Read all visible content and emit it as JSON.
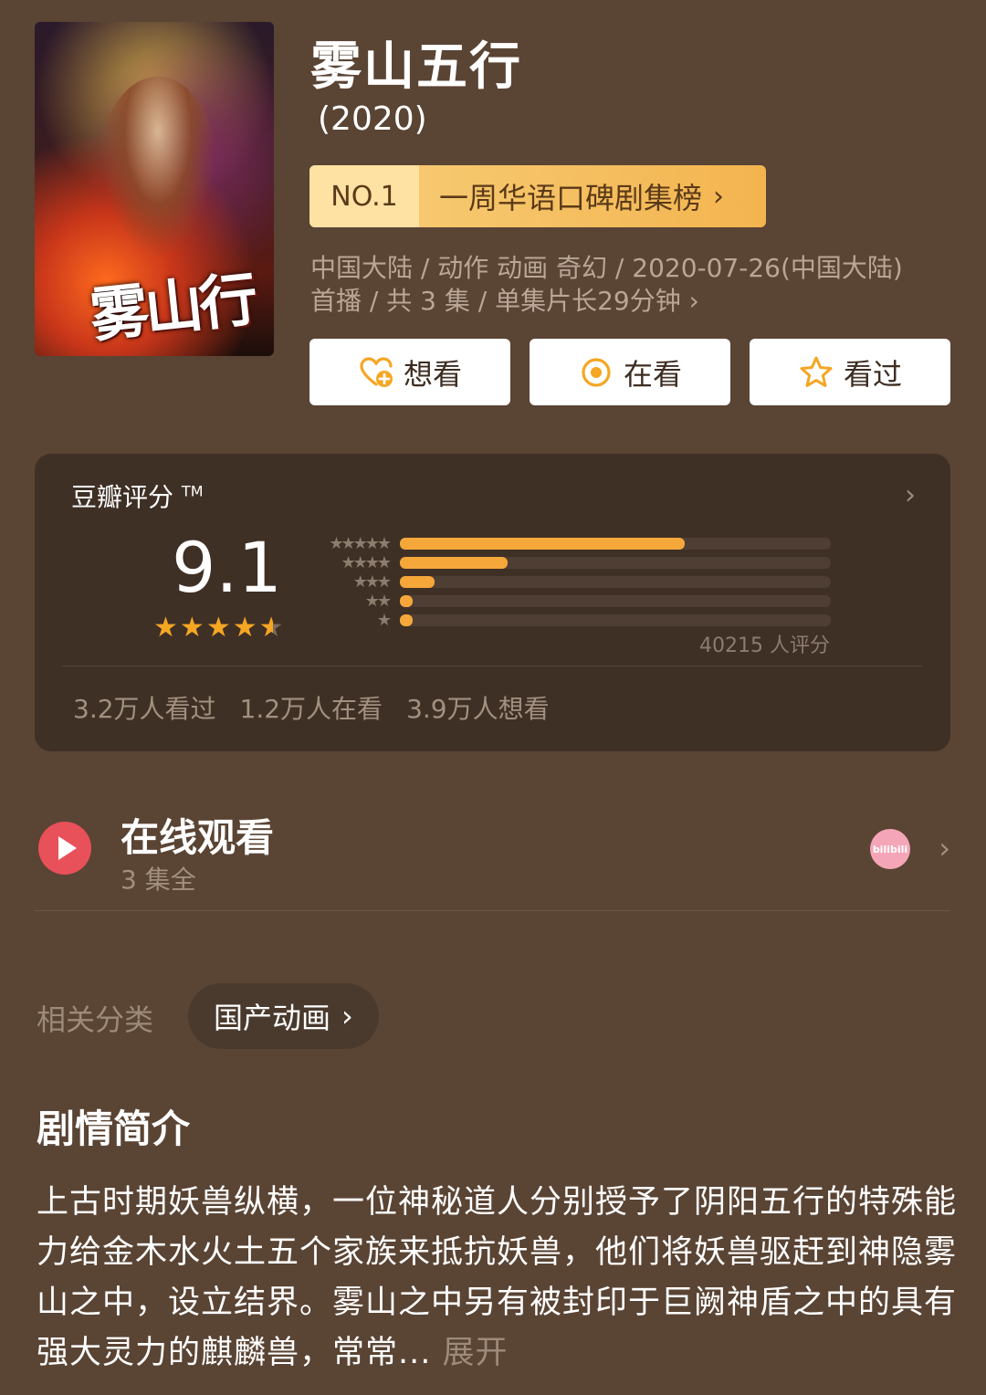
{
  "poster": {
    "logo_text": "雾山行"
  },
  "header": {
    "title": "雾山五行",
    "year": "(2020)"
  },
  "rank": {
    "no": "NO.1",
    "text": "一周华语口碑剧集榜",
    "chevron": "›"
  },
  "meta": {
    "line1": "中国大陆 / 动作 动画 奇幻 / 2020-07-26(中国大陆)",
    "line2": "首播 / 共 3 集 / 单集片长29分钟 ›"
  },
  "actions": [
    {
      "label": "想看",
      "icon": "heart-plus-icon"
    },
    {
      "label": "在看",
      "icon": "target-circle-icon"
    },
    {
      "label": "看过",
      "icon": "star-outline-icon"
    }
  ],
  "rating": {
    "label": "豆瓣评分",
    "tm": "TM",
    "score": "9.1",
    "stars_value": 4.5,
    "distribution": [
      {
        "stars": "★★★★★",
        "fraction": 0.66
      },
      {
        "stars": "★★★★",
        "fraction": 0.25
      },
      {
        "stars": "★★★",
        "fraction": 0.08
      },
      {
        "stars": "★★",
        "fraction": 0.03
      },
      {
        "stars": "★",
        "fraction": 0.03
      }
    ],
    "count": "40215 人评分",
    "stats": {
      "watched": "3.2万人看过",
      "watching": "1.2万人在看",
      "want": "3.9万人想看"
    }
  },
  "online": {
    "title": "在线观看",
    "sub": "3 集全",
    "provider_icon": "bilibili-icon",
    "provider_text": "bilibili"
  },
  "category": {
    "label": "相关分类",
    "chip": "国产动画"
  },
  "synopsis": {
    "title": "剧情简介",
    "text": "上古时期妖兽纵横，一位神秘道人分别授予了阴阳五行的特殊能力给金木水火土五个家族来抵抗妖兽，他们将妖兽驱赶到神隐雾山之中，设立结界。雾山之中另有被封印于巨阙神盾之中的具有强大灵力的麒麟兽，常常...",
    "expand": "展开"
  },
  "colors": {
    "background": "#5a4434",
    "card": "#3f3026",
    "accent": "#f5a623",
    "play": "#e8505a"
  }
}
